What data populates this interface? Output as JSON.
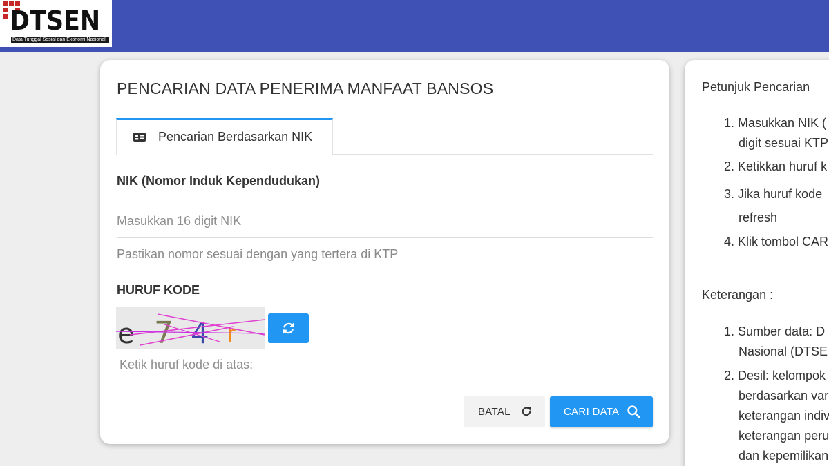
{
  "header": {
    "logo_text": "DTSEN",
    "logo_subtitle": "Data Tunggal Sosial dan Ekonomi Nasional"
  },
  "form": {
    "title": "PENCARIAN DATA PENERIMA MANFAAT BANSOS",
    "tab_label": "Pencarian Berdasarkan NIK",
    "nik_label": "NIK (Nomor Induk Kependudukan)",
    "nik_placeholder": "Masukkan 16 digit NIK",
    "nik_hint": "Pastikan nomor sesuai dengan yang tertera di KTP",
    "kode_label": "HURUF KODE",
    "captcha_chars": [
      "e",
      "7",
      "4",
      "r"
    ],
    "kode_placeholder": "Ketik huruf kode di atas:",
    "batal_label": "BATAL",
    "cari_label": "CARI DATA"
  },
  "sidebar": {
    "petunjuk_title": "Petunjuk Pencarian",
    "petunjuk_lines": [
      "1. Masukkan NIK (",
      "digit sesuai KTP",
      "2. Ketikkan huruf k",
      "3. Jika huruf kode",
      "refresh",
      "4. Klik tombol CAR"
    ],
    "keterangan_title": "Keterangan :",
    "keterangan_lines": [
      "1. Sumber data: D",
      "Nasional (DTSE",
      "2. Desil: kelompok",
      "berdasarkan var",
      "keterangan indiv",
      "keterangan peru",
      "dan kepemilikan"
    ]
  },
  "colors": {
    "header_bg": "#3f51b5",
    "primary": "#2196f3",
    "logo_red": "#c62828"
  },
  "icons": {
    "tab": "id-card-icon",
    "refresh": "refresh-icon",
    "batal": "reset-icon",
    "cari": "search-icon"
  }
}
